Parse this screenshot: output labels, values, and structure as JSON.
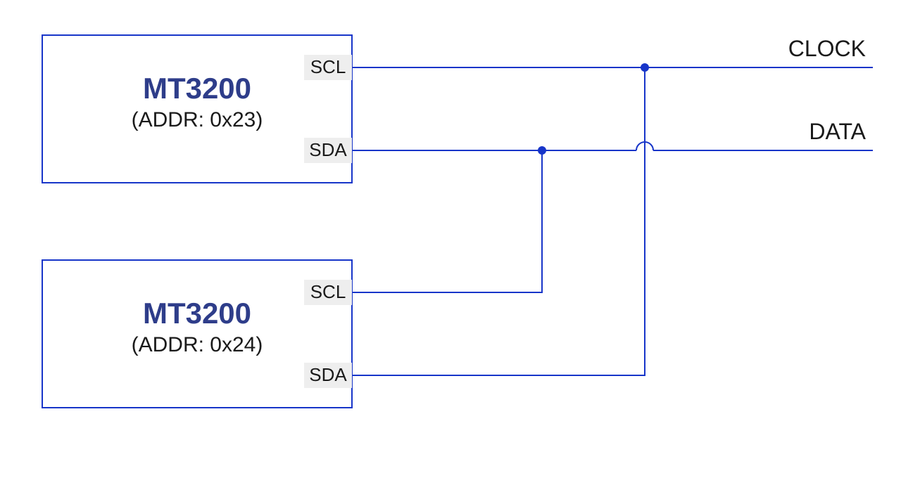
{
  "devices": [
    {
      "name": "MT3200",
      "addr_label": "(ADDR: 0x23)",
      "pins": {
        "scl": "SCL",
        "sda": "SDA"
      }
    },
    {
      "name": "MT3200",
      "addr_label": "(ADDR: 0x24)",
      "pins": {
        "scl": "SCL",
        "sda": "SDA"
      }
    }
  ],
  "bus": {
    "clock_label": "CLOCK",
    "data_label": "DATA"
  },
  "colors": {
    "wire": "#1735c9",
    "chip_title": "#2e3d8a",
    "pin_bg": "#eeeeee"
  }
}
